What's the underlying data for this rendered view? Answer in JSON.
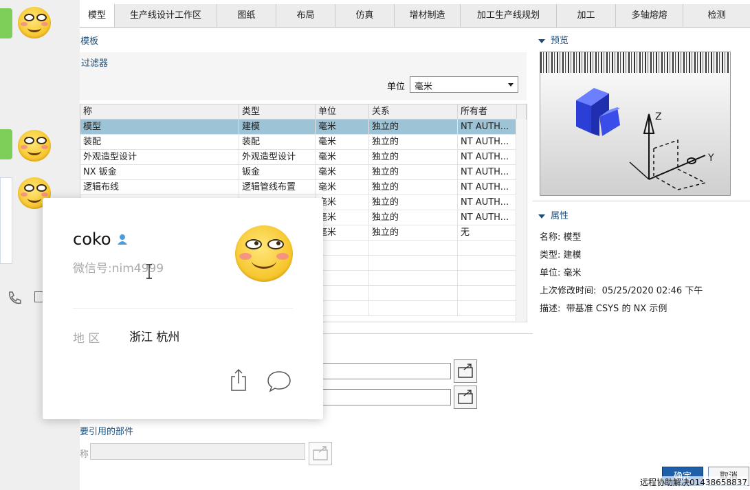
{
  "tabs": [
    "模型",
    "生产线设计工作区",
    "图纸",
    "布局",
    "仿真",
    "增材制造",
    "加工生产线规划",
    "加工",
    "多轴熔熔",
    "检测"
  ],
  "section_templates": "模板",
  "section_filter": "过滤器",
  "unit_label": "单位",
  "unit_value": "毫米",
  "table": {
    "headers": [
      "称",
      "类型",
      "单位",
      "关系",
      "所有者"
    ],
    "rows": [
      [
        "模型",
        "建模",
        "毫米",
        "独立的",
        "NT AUTH..."
      ],
      [
        "装配",
        "装配",
        "毫米",
        "独立的",
        "NT AUTH..."
      ],
      [
        "外观造型设计",
        "外观造型设计",
        "毫米",
        "独立的",
        "NT AUTH..."
      ],
      [
        "NX 钣金",
        "钣金",
        "毫米",
        "独立的",
        "NT AUTH..."
      ],
      [
        "逻辑布线",
        "逻辑管线布置",
        "毫米",
        "独立的",
        "NT AUTH..."
      ],
      [
        "",
        "",
        "毫米",
        "独立的",
        "NT AUTH..."
      ],
      [
        "",
        "",
        "毫米",
        "独立的",
        "NT AUTH..."
      ],
      [
        "",
        "",
        "毫米",
        "独立的",
        "无"
      ]
    ]
  },
  "preview_title": "预览",
  "axis_z": "Z",
  "axis_y": "Y",
  "properties_title": "属性",
  "properties": [
    {
      "label": "名称:",
      "value": "模型"
    },
    {
      "label": "类型:",
      "value": "建模"
    },
    {
      "label": "单位:",
      "value": "毫米"
    },
    {
      "label": "上次修改时间:",
      "value": "05/25/2020 02:46 下午"
    },
    {
      "label": "描述:",
      "value": "带基准 CSYS 的 NX 示例"
    }
  ],
  "referenced_parts_label": "要引用的部件",
  "name_field_label": "称",
  "profile": {
    "name": "coko",
    "wechat_label": "微信号:",
    "wechat_id": "nim4999",
    "region_label": "地 区",
    "region_value": "浙江 杭州"
  },
  "ok_button": "确定",
  "cancel_button": "取消",
  "watermark": "远程协助解决01438658837",
  "colors": {
    "selected_row": "#9cc3d6",
    "section_text": "#1f4e79",
    "chat_green": "#7dcf5a",
    "primary_button": "#1e5fa8"
  }
}
